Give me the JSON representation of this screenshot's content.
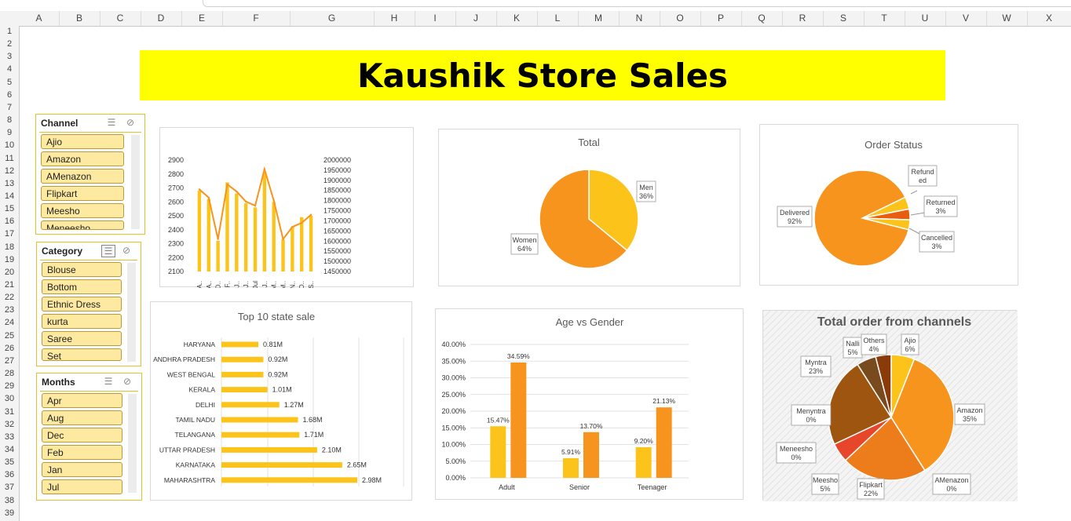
{
  "columns": [
    "A",
    "B",
    "C",
    "D",
    "E",
    "F",
    "G",
    "H",
    "I",
    "J",
    "K",
    "L",
    "M",
    "N",
    "O",
    "P",
    "Q",
    "R",
    "S",
    "T",
    "U",
    "V",
    "W",
    "X"
  ],
  "rows": [
    "1",
    "2",
    "3",
    "4",
    "5",
    "6",
    "7",
    "8",
    "9",
    "10",
    "11",
    "12",
    "13",
    "14",
    "15",
    "16",
    "17",
    "18",
    "19",
    "20",
    "21",
    "22",
    "23",
    "24",
    "25",
    "26",
    "27",
    "28",
    "29",
    "30",
    "31",
    "32",
    "33",
    "34",
    "35",
    "36",
    "37",
    "38",
    "39"
  ],
  "title": "Kaushik Store Sales",
  "slicers": {
    "channel": {
      "header": "Channel",
      "items": [
        "Ajio",
        "Amazon",
        "AMenazon",
        "Flipkart",
        "Meesho",
        "Meneesho"
      ]
    },
    "category": {
      "header": "Category",
      "items": [
        "Blouse",
        "Bottom",
        "Ethnic Dress",
        "kurta",
        "Saree",
        "Set"
      ]
    },
    "months": {
      "header": "Months",
      "items": [
        "Apr",
        "Aug",
        "Dec",
        "Feb",
        "Jan",
        "Jul"
      ]
    }
  },
  "colors": {
    "accent": "#f7941d",
    "gold": "#fcc41a",
    "title_bg": "#ffff00",
    "slicer_item": "#fde9a0"
  },
  "chart_data": [
    {
      "type": "bar",
      "title": "",
      "categories": [
        "A..",
        "A..",
        "D..",
        "F..",
        "J..",
        "J..",
        "Jul",
        "J..",
        "M..",
        "M..",
        "N..",
        "O..",
        "S.."
      ],
      "series": [
        {
          "axis": "left",
          "values": [
            2680,
            2620,
            2320,
            2740,
            2660,
            2590,
            2560,
            2810,
            2600,
            2330,
            2420,
            2490,
            2500
          ]
        },
        {
          "axis": "right",
          "values": [
            1855000,
            1815000,
            1610000,
            1880000,
            1845000,
            1795000,
            1775000,
            1955000,
            1800000,
            1610000,
            1670000,
            1690000,
            1730000
          ]
        }
      ],
      "left_ticks": [
        "2900",
        "2800",
        "2700",
        "2600",
        "2500",
        "2400",
        "2300",
        "2200",
        "2100"
      ],
      "right_ticks": [
        "2000000",
        "1950000",
        "1900000",
        "1850000",
        "1800000",
        "1750000",
        "1700000",
        "1650000",
        "1600000",
        "1550000",
        "1500000",
        "1450000"
      ],
      "ylim_left": [
        2100,
        2900
      ],
      "ylim_right": [
        1450000,
        2000000
      ]
    },
    {
      "type": "pie",
      "title": "Total",
      "labels": [
        "Men",
        "Women"
      ],
      "values": [
        36,
        64
      ],
      "label_text": [
        "36%",
        "64%"
      ]
    },
    {
      "type": "pie",
      "title": "Order Status",
      "labels": [
        "Delivered",
        "Refunded",
        "Returned",
        "Cancelled"
      ],
      "label_names": [
        "Delivered",
        "Refund ed",
        "Returned",
        "Cancelled"
      ],
      "values": [
        92,
        1,
        3,
        3
      ],
      "label_text": [
        "92%",
        "",
        "3%",
        "3%"
      ]
    },
    {
      "type": "bar",
      "orientation": "horizontal",
      "title": "Top 10 state sale",
      "categories": [
        "HARYANA",
        "ANDHRA PRADESH",
        "WEST BENGAL",
        "KERALA",
        "DELHI",
        "TAMIL NADU",
        "TELANGANA",
        "UTTAR PRADESH",
        "KARNATAKA",
        "MAHARASHTRA"
      ],
      "values": [
        0.81,
        0.92,
        0.92,
        1.01,
        1.27,
        1.68,
        1.71,
        2.1,
        2.65,
        2.98
      ],
      "value_labels": [
        "0.81M",
        "0.92M",
        "0.92M",
        "1.01M",
        "1.27M",
        "1.68M",
        "1.71M",
        "2.10M",
        "2.65M",
        "2.98M"
      ]
    },
    {
      "type": "bar",
      "title": "Age vs Gender",
      "categories": [
        "Adult",
        "Senior",
        "Teenager"
      ],
      "series": [
        {
          "values": [
            15.47,
            5.91,
            9.2
          ],
          "labels": [
            "15.47%",
            "5.91%",
            "9.20%"
          ]
        },
        {
          "values": [
            34.59,
            13.7,
            21.13
          ],
          "labels": [
            "34.59%",
            "13.70%",
            "21.13%"
          ]
        }
      ],
      "y_ticks": [
        "40.00%",
        "35.00%",
        "30.00%",
        "25.00%",
        "20.00%",
        "15.00%",
        "10.00%",
        "5.00%",
        "0.00%"
      ],
      "ylim": [
        0,
        40
      ]
    },
    {
      "type": "pie",
      "title": "Total order from channels",
      "labels": [
        "Ajio",
        "Amazon",
        "AMenazon",
        "Flipkart",
        "Meesho",
        "Meneesho",
        "Menyntra",
        "Myntra",
        "Nalli",
        "Others"
      ],
      "values": [
        6,
        35,
        0,
        22,
        5,
        0,
        0,
        23,
        5,
        4
      ],
      "label_text": [
        "6%",
        "35%",
        "0%",
        "22%",
        "5%",
        "0%",
        "0%",
        "23%",
        "5%",
        "4%"
      ]
    }
  ]
}
